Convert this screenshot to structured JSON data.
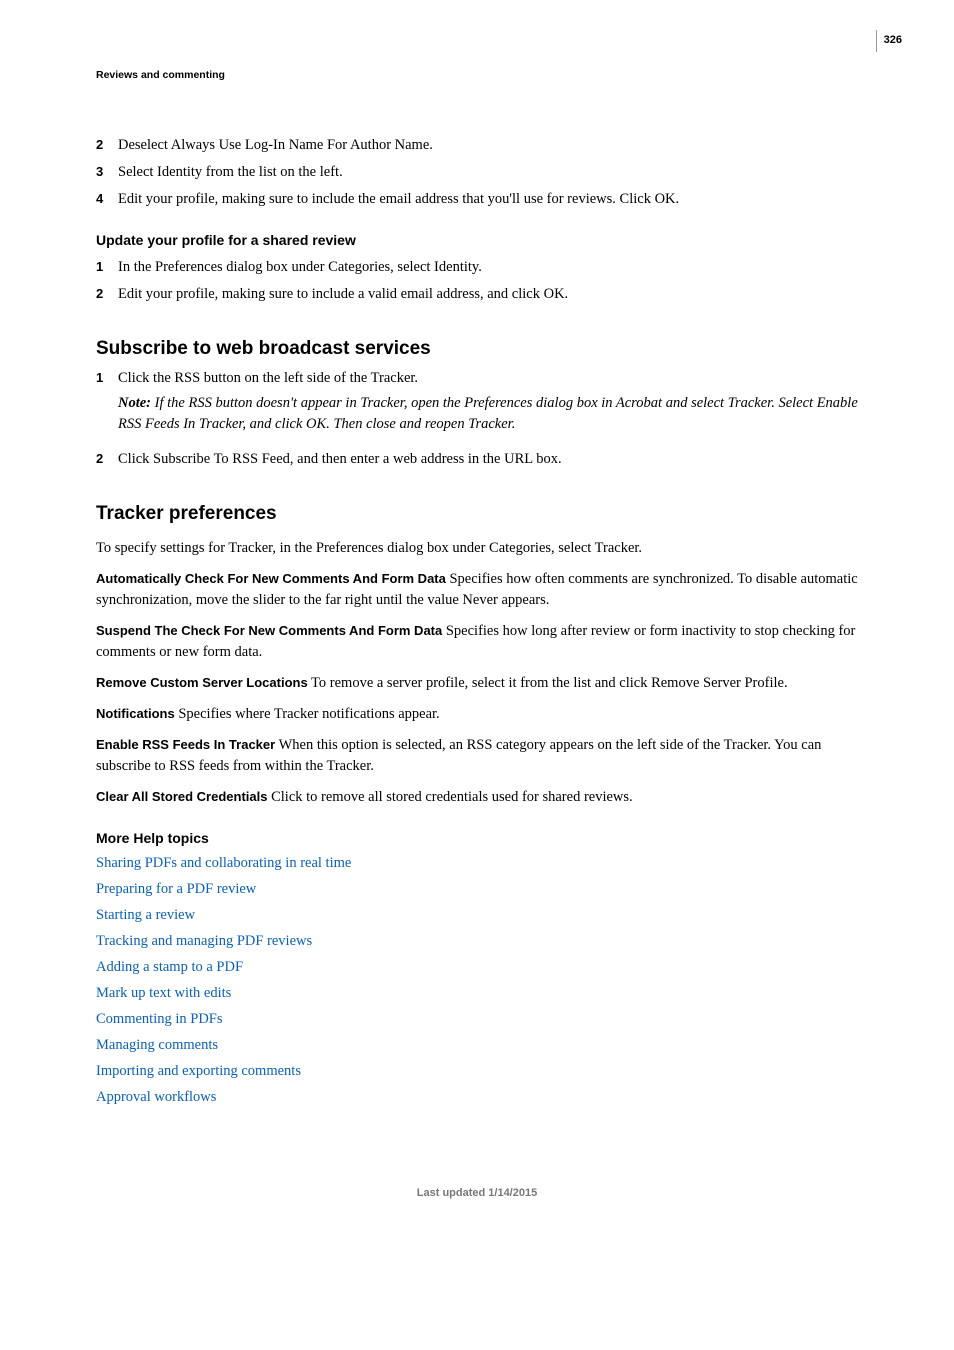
{
  "pageNumber": "326",
  "runningHead": "Reviews and commenting",
  "steps1": [
    {
      "num": "2",
      "text": "Deselect Always Use Log-In Name For Author Name."
    },
    {
      "num": "3",
      "text": "Select Identity from the list on the left."
    },
    {
      "num": "4",
      "text": "Edit your profile, making sure to include the email address that you'll use for reviews. Click OK."
    }
  ],
  "updateHeading": "Update your profile for a shared review",
  "steps2": [
    {
      "num": "1",
      "text": "In the Preferences dialog box under Categories, select Identity."
    },
    {
      "num": "2",
      "text": "Edit your profile, making sure to include a valid email address, and click OK."
    }
  ],
  "subscribeHeading": "Subscribe to web broadcast services",
  "steps3": [
    {
      "num": "1",
      "text": "Click the RSS button on the left side of the Tracker.",
      "noteLabel": "Note: ",
      "noteText": "If the RSS button doesn't appear in Tracker, open the Preferences dialog box in Acrobat and select Tracker. Select Enable RSS Feeds In Tracker, and click OK. Then close and reopen Tracker."
    },
    {
      "num": "2",
      "text": "Click Subscribe To RSS Feed, and then enter a web address in the URL box."
    }
  ],
  "trackerHeading": "Tracker preferences",
  "trackerIntro": "To specify settings for Tracker, in the Preferences dialog box under Categories, select Tracker.",
  "prefs": [
    {
      "label": "Automatically Check For New Comments And Form Data",
      "text": "  Specifies how often comments are synchronized. To disable automatic synchronization, move the slider to the far right until the value Never appears."
    },
    {
      "label": "Suspend The Check For New Comments And Form Data",
      "text": "  Specifies how long after review or form inactivity to stop checking for comments or new form data."
    },
    {
      "label": "Remove Custom Server Locations",
      "text": "  To remove a server profile, select it from the list and click Remove Server Profile."
    },
    {
      "label": "Notifications",
      "text": "  Specifies where Tracker notifications appear."
    },
    {
      "label": "Enable RSS Feeds In Tracker",
      "text": "  When this option is selected, an RSS category appears on the left side of the Tracker. You can subscribe to RSS feeds from within the Tracker."
    },
    {
      "label": "Clear All Stored Credentials",
      "text": "  Click to remove all stored credentials used for shared reviews."
    }
  ],
  "moreHelpHeading": "More Help topics",
  "links": [
    "Sharing PDFs and collaborating in real time",
    "Preparing for a PDF review",
    "Starting a review",
    "Tracking and managing PDF reviews",
    "Adding a stamp to a PDF",
    "Mark up text with edits",
    "Commenting in PDFs",
    "Managing comments",
    "Importing and exporting comments",
    "Approval workflows"
  ],
  "footer": "Last updated 1/14/2015"
}
